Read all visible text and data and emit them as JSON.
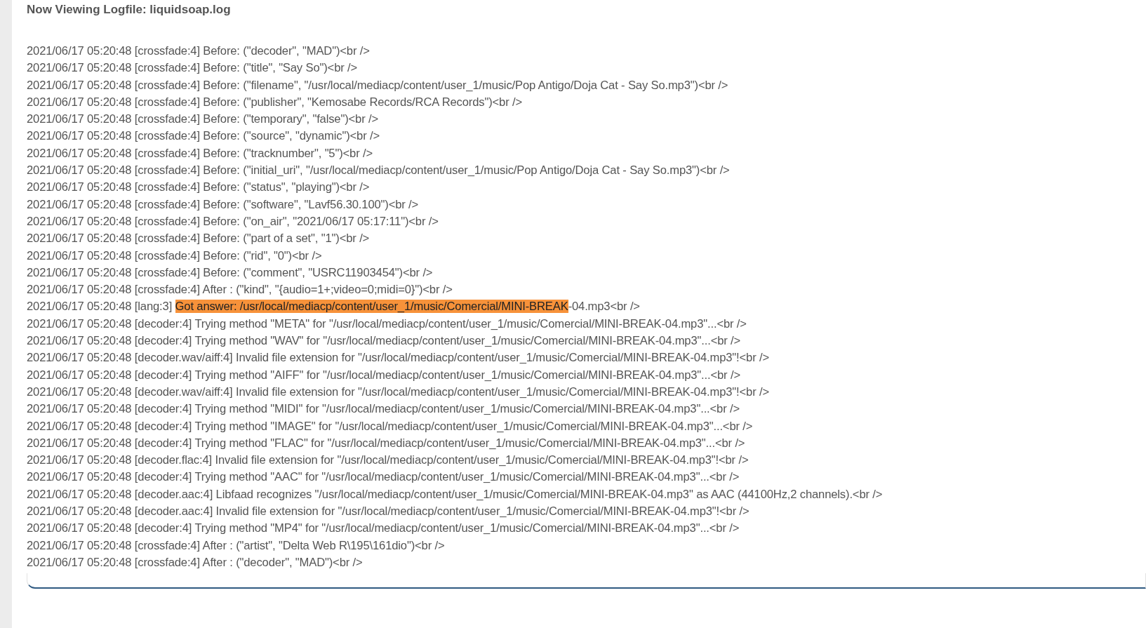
{
  "heading": "Now Viewing Logfile: liquidsoap.log",
  "lines": [
    {
      "text": "2021/06/17 05:20:48 [crossfade:4] Before: (\"decoder\", \"MAD\")<br />"
    },
    {
      "text": "2021/06/17 05:20:48 [crossfade:4] Before: (\"title\", \"Say So\")<br />"
    },
    {
      "text": "2021/06/17 05:20:48 [crossfade:4] Before: (\"filename\", \"/usr/local/mediacp/content/user_1/music/Pop Antigo/Doja Cat - Say So.mp3\")<br />"
    },
    {
      "text": "2021/06/17 05:20:48 [crossfade:4] Before: (\"publisher\", \"Kemosabe Records/RCA Records\")<br />"
    },
    {
      "text": "2021/06/17 05:20:48 [crossfade:4] Before: (\"temporary\", \"false\")<br />"
    },
    {
      "text": "2021/06/17 05:20:48 [crossfade:4] Before: (\"source\", \"dynamic\")<br />"
    },
    {
      "text": "2021/06/17 05:20:48 [crossfade:4] Before: (\"tracknumber\", \"5\")<br />"
    },
    {
      "text": "2021/06/17 05:20:48 [crossfade:4] Before: (\"initial_uri\", \"/usr/local/mediacp/content/user_1/music/Pop Antigo/Doja Cat - Say So.mp3\")<br />"
    },
    {
      "text": "2021/06/17 05:20:48 [crossfade:4] Before: (\"status\", \"playing\")<br />"
    },
    {
      "text": "2021/06/17 05:20:48 [crossfade:4] Before: (\"software\", \"Lavf56.30.100\")<br />"
    },
    {
      "text": "2021/06/17 05:20:48 [crossfade:4] Before: (\"on_air\", \"2021/06/17 05:17:11\")<br />"
    },
    {
      "text": "2021/06/17 05:20:48 [crossfade:4] Before: (\"part of a set\", \"1\")<br />"
    },
    {
      "text": "2021/06/17 05:20:48 [crossfade:4] Before: (\"rid\", \"0\")<br />"
    },
    {
      "text": "2021/06/17 05:20:48 [crossfade:4] Before: (\"comment\", \"USRC11903454\")<br />"
    },
    {
      "text": "2021/06/17 05:20:48 [crossfade:4] After : (\"kind\", \"{audio=1+;video=0;midi=0}\")<br />"
    },
    {
      "text": "2021/06/17 05:20:48 [lang:3] ",
      "highlight": "Got answer: /usr/local/mediacp/content/user_1/music/Comercial/MINI-BREAK",
      "after": "-04.mp3<br />"
    },
    {
      "text": "2021/06/17 05:20:48 [decoder:4] Trying method \"META\" for \"/usr/local/mediacp/content/user_1/music/Comercial/MINI-BREAK-04.mp3\"...<br />"
    },
    {
      "text": "2021/06/17 05:20:48 [decoder:4] Trying method \"WAV\" for \"/usr/local/mediacp/content/user_1/music/Comercial/MINI-BREAK-04.mp3\"...<br />"
    },
    {
      "text": "2021/06/17 05:20:48 [decoder.wav/aiff:4] Invalid file extension for \"/usr/local/mediacp/content/user_1/music/Comercial/MINI-BREAK-04.mp3\"!<br />"
    },
    {
      "text": "2021/06/17 05:20:48 [decoder:4] Trying method \"AIFF\" for \"/usr/local/mediacp/content/user_1/music/Comercial/MINI-BREAK-04.mp3\"...<br />"
    },
    {
      "text": "2021/06/17 05:20:48 [decoder.wav/aiff:4] Invalid file extension for \"/usr/local/mediacp/content/user_1/music/Comercial/MINI-BREAK-04.mp3\"!<br />"
    },
    {
      "text": "2021/06/17 05:20:48 [decoder:4] Trying method \"MIDI\" for \"/usr/local/mediacp/content/user_1/music/Comercial/MINI-BREAK-04.mp3\"...<br />"
    },
    {
      "text": "2021/06/17 05:20:48 [decoder:4] Trying method \"IMAGE\" for \"/usr/local/mediacp/content/user_1/music/Comercial/MINI-BREAK-04.mp3\"...<br />"
    },
    {
      "text": "2021/06/17 05:20:48 [decoder:4] Trying method \"FLAC\" for \"/usr/local/mediacp/content/user_1/music/Comercial/MINI-BREAK-04.mp3\"...<br />"
    },
    {
      "text": "2021/06/17 05:20:48 [decoder.flac:4] Invalid file extension for \"/usr/local/mediacp/content/user_1/music/Comercial/MINI-BREAK-04.mp3\"!<br />"
    },
    {
      "text": "2021/06/17 05:20:48 [decoder:4] Trying method \"AAC\" for \"/usr/local/mediacp/content/user_1/music/Comercial/MINI-BREAK-04.mp3\"...<br />"
    },
    {
      "text": "2021/06/17 05:20:48 [decoder.aac:4] Libfaad recognizes \"/usr/local/mediacp/content/user_1/music/Comercial/MINI-BREAK-04.mp3\" as AAC (44100Hz,2 channels).<br />"
    },
    {
      "text": "2021/06/17 05:20:48 [decoder.aac:4] Invalid file extension for \"/usr/local/mediacp/content/user_1/music/Comercial/MINI-BREAK-04.mp3\"!<br />"
    },
    {
      "text": "2021/06/17 05:20:48 [decoder:4] Trying method \"MP4\" for \"/usr/local/mediacp/content/user_1/music/Comercial/MINI-BREAK-04.mp3\"...<br />"
    },
    {
      "text": "2021/06/17 05:20:48 [crossfade:4] After : (\"artist\", \"Delta Web R\\195\\161dio\")<br />"
    },
    {
      "text": "2021/06/17 05:20:48 [crossfade:4] After : (\"decoder\", \"MAD\")<br />"
    }
  ]
}
